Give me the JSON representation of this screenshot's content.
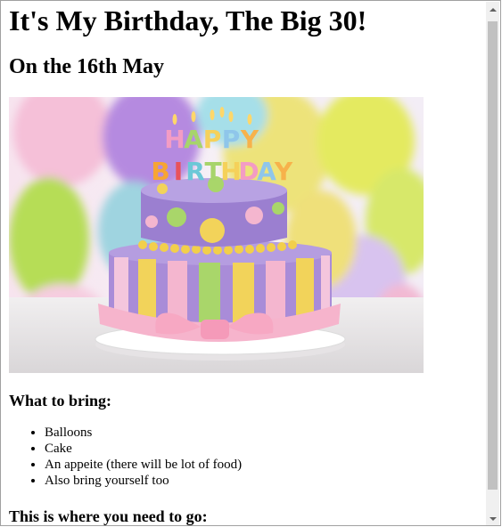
{
  "page": {
    "title": "It's My Birthday, The Big 30!",
    "subtitle": "On the 16th May",
    "image_alt": "Birthday cake",
    "cake_letters": [
      "H",
      "A",
      "P",
      "P",
      "Y",
      "B",
      "I",
      "R",
      "T",
      "H",
      "D",
      "A",
      "Y"
    ],
    "bring_heading": "What to bring:",
    "bring_items": [
      "Balloons",
      "Cake",
      "An appeite (there will be lot of food)",
      "Also bring yourself too"
    ],
    "go_heading": "This is where you need to go:"
  },
  "colors": {
    "scroll_track": "#f0f0f0",
    "scroll_thumb": "#c1c1c1",
    "cake_purple": "#9b7fd0",
    "cake_pink": "#f4b6cf",
    "cake_yellow": "#f2d35a",
    "cake_green": "#a9d66a"
  },
  "scrollbar": {
    "position_fraction": 0.0
  }
}
